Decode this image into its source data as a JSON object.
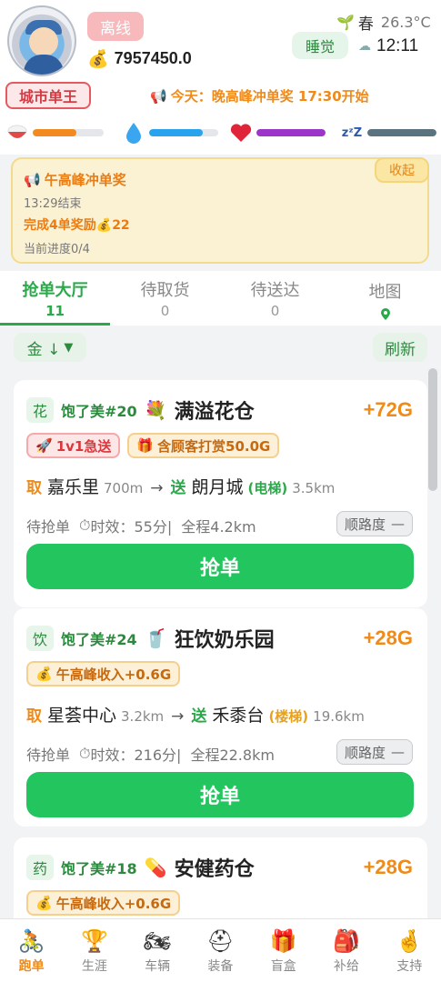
{
  "header": {
    "status_badge": "离线",
    "money": "7957450.0",
    "season": "春",
    "temperature": "26.3°C",
    "sleep_label": "睡觉",
    "time": "12:11",
    "title_badge": "城市单王",
    "notice": "今天：晚高峰冲单奖 17:30开始",
    "stats": [
      {
        "icon": "food-bowl-icon",
        "level": 0.62,
        "color": "#f28a1f"
      },
      {
        "icon": "water-drop-icon",
        "level": 0.78,
        "color": "#2aa3ee"
      },
      {
        "icon": "heart-icon",
        "level": 1.0,
        "color": "#9b36c9"
      },
      {
        "icon": "sleep-zzz-icon",
        "level": 1.0,
        "color": "#5b7380"
      }
    ]
  },
  "task": {
    "title": "午高峰冲单奖",
    "end_time": "13:29结束",
    "reward_prefix": "完成4单奖励",
    "reward_amount": "22",
    "progress": "当前进度0/4",
    "collapse_label": "收起"
  },
  "tabs": [
    {
      "label": "抢单大厅",
      "count": "11",
      "active": true
    },
    {
      "label": "待取货",
      "count": "0",
      "active": false
    },
    {
      "label": "待送达",
      "count": "0",
      "active": false
    },
    {
      "label": "地图",
      "count": "",
      "active": false,
      "icon": "map-pin-icon"
    }
  ],
  "filter": {
    "sort_label": "金 ↓",
    "refresh_label": "刷新"
  },
  "orders": [
    {
      "category": "花",
      "shop_no": "饱了美#20",
      "shop_emoji": "💐",
      "shop_name": "满溢花仓",
      "price": "+72G",
      "tags": [
        {
          "emoji": "🚀",
          "text": "1v1急送",
          "style": "red"
        },
        {
          "emoji": "🎁",
          "text": "含顾客打赏50.0G",
          "style": "gold"
        }
      ],
      "pick_label": "取",
      "pick_place": "嘉乐里",
      "pick_dist": "700m",
      "arrow": "→",
      "drop_label": "送",
      "drop_place": "朗月城",
      "drop_extra": "(电梯)",
      "drop_extra_color": "green",
      "drop_dist": "3.5km",
      "status": "待抢单",
      "timeliness": "时效：55分|",
      "total": "全程4.2km",
      "smooth_label": "顺路度",
      "smooth_value": "—",
      "grab_label": "抢单"
    },
    {
      "category": "饮",
      "shop_no": "饱了美#24",
      "shop_emoji": "🥤",
      "shop_name": "狂饮奶乐园",
      "price": "+28G",
      "tags": [
        {
          "emoji": "💰",
          "text": "午高峰收入+0.6G",
          "style": "gold"
        }
      ],
      "pick_label": "取",
      "pick_place": "星荟中心",
      "pick_dist": "3.2km",
      "arrow": "→",
      "drop_label": "送",
      "drop_place": "禾黍台",
      "drop_extra": "(楼梯)",
      "drop_extra_color": "orange",
      "drop_dist": "19.6km",
      "status": "待抢单",
      "timeliness": "时效：216分|",
      "total": "全程22.8km",
      "smooth_label": "顺路度",
      "smooth_value": "—",
      "grab_label": "抢单"
    },
    {
      "category": "药",
      "shop_no": "饱了美#18",
      "shop_emoji": "💊",
      "shop_name": "安健药仓",
      "price": "+28G",
      "tags": [
        {
          "emoji": "💰",
          "text": "午高峰收入+0.6G",
          "style": "gold"
        }
      ],
      "pick_label": "",
      "pick_place": "",
      "pick_dist": "",
      "arrow": "",
      "drop_label": "",
      "drop_place": "",
      "drop_extra": "",
      "drop_extra_color": "green",
      "drop_dist": "",
      "status": "",
      "timeliness": "",
      "total": "",
      "smooth_label": "",
      "smooth_value": "",
      "grab_label": ""
    }
  ],
  "bottom_nav": [
    {
      "icon": "rider-icon",
      "emoji": "🚴",
      "label": "跑单",
      "active": true
    },
    {
      "icon": "trophy-icon",
      "emoji": "🏆",
      "label": "生涯",
      "active": false
    },
    {
      "icon": "motorcycle-icon",
      "emoji": "🏍",
      "label": "车辆",
      "active": false
    },
    {
      "icon": "helmet-icon",
      "emoji": "⛑",
      "label": "装备",
      "active": false
    },
    {
      "icon": "gift-box-icon",
      "emoji": "🎁",
      "label": "盲盒",
      "active": false
    },
    {
      "icon": "backpack-icon",
      "emoji": "🎒",
      "label": "补给",
      "active": false
    },
    {
      "icon": "support-hands-icon",
      "emoji": "🤞",
      "label": "支持",
      "active": false
    }
  ]
}
